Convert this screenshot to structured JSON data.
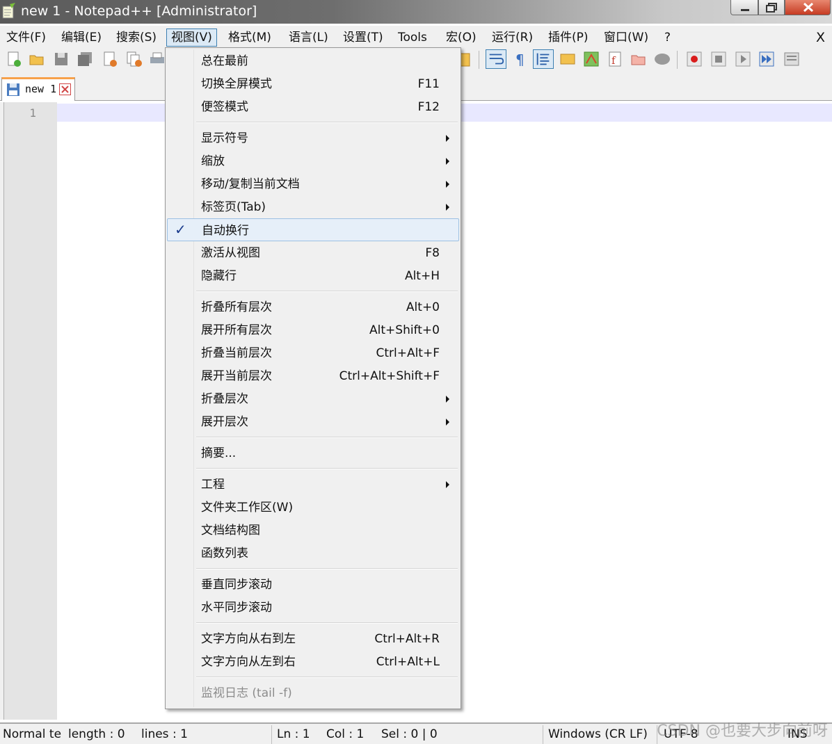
{
  "window": {
    "title": "new 1 - Notepad++ [Administrator]"
  },
  "menubar": {
    "items": [
      "文件(F)",
      "编辑(E)",
      "搜索(S)",
      "视图(V)",
      "格式(M)",
      "语言(L)",
      "设置(T)",
      "Tools",
      "宏(O)",
      "运行(R)",
      "插件(P)",
      "窗口(W)",
      "?"
    ],
    "active_index": 3,
    "close_label": "X"
  },
  "tab": {
    "label": "new  1"
  },
  "editor": {
    "line_number": "1"
  },
  "view_menu": {
    "groups": [
      [
        {
          "label": "总在最前",
          "shortcut": ""
        },
        {
          "label": "切换全屏模式",
          "shortcut": "F11"
        },
        {
          "label": "便签模式",
          "shortcut": "F12"
        }
      ],
      [
        {
          "label": "显示符号",
          "submenu": true
        },
        {
          "label": "缩放",
          "submenu": true
        },
        {
          "label": "移动/复制当前文档",
          "submenu": true
        },
        {
          "label": "标签页(Tab)",
          "submenu": true
        },
        {
          "label": "自动换行",
          "checked": true,
          "highlighted": true
        },
        {
          "label": "激活从视图",
          "shortcut": "F8"
        },
        {
          "label": "隐藏行",
          "shortcut": "Alt+H"
        }
      ],
      [
        {
          "label": "折叠所有层次",
          "shortcut": "Alt+0"
        },
        {
          "label": "展开所有层次",
          "shortcut": "Alt+Shift+0"
        },
        {
          "label": "折叠当前层次",
          "shortcut": "Ctrl+Alt+F"
        },
        {
          "label": "展开当前层次",
          "shortcut": "Ctrl+Alt+Shift+F"
        },
        {
          "label": "折叠层次",
          "submenu": true
        },
        {
          "label": "展开层次",
          "submenu": true
        }
      ],
      [
        {
          "label": "摘要..."
        }
      ],
      [
        {
          "label": "工程",
          "submenu": true
        },
        {
          "label": "文件夹工作区(W)"
        },
        {
          "label": "文档结构图"
        },
        {
          "label": "函数列表"
        }
      ],
      [
        {
          "label": "垂直同步滚动"
        },
        {
          "label": "水平同步滚动"
        }
      ],
      [
        {
          "label": "文字方向从右到左",
          "shortcut": "Ctrl+Alt+R"
        },
        {
          "label": "文字方向从左到右",
          "shortcut": "Ctrl+Alt+L"
        }
      ],
      [
        {
          "label": "监视日志 (tail -f)",
          "disabled": true
        }
      ]
    ]
  },
  "statusbar": {
    "type": "Normal te",
    "length": "length : 0",
    "lines": "lines : 1",
    "ln": "Ln : 1",
    "col": "Col : 1",
    "sel": "Sel : 0 | 0",
    "eol": "Windows (CR LF)",
    "encoding": "UTF-8",
    "mode": "INS"
  },
  "watermark": "CSDN @也要大步向前呀",
  "colors": {
    "current_line": "#e8e8ff",
    "menu_highlight": "#e6eff9",
    "tab_accent": "#f7a14a"
  }
}
